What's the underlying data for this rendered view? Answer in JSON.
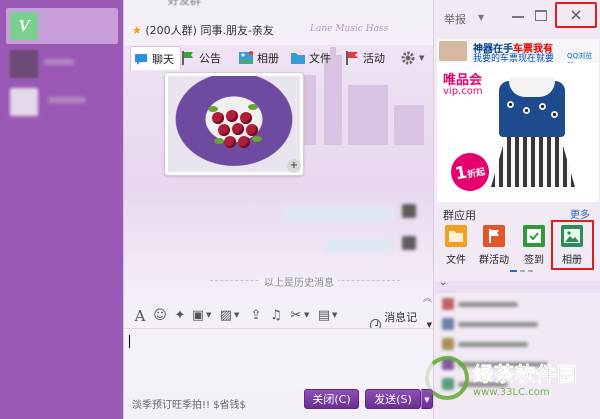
{
  "chat": {
    "top_clip_text": "好友群",
    "group_member_count": "(200人群)",
    "group_name": "同事.朋友-亲友",
    "background_script": "Lane Music Hass",
    "tabs": [
      {
        "label": "聊天",
        "icon": "chat-bubble-icon",
        "active": true
      },
      {
        "label": "公告",
        "icon": "flag-icon",
        "active": false
      },
      {
        "label": "相册",
        "icon": "photo-album-icon",
        "active": false
      },
      {
        "label": "文件",
        "icon": "folder-icon",
        "active": false
      },
      {
        "label": "活动",
        "icon": "activity-flag-icon",
        "active": false
      }
    ],
    "history_divider": "以上是历史消息",
    "message_history_label": "消息记录",
    "footer_tip": "淡季预订旺季拍!! $省钱$",
    "close_label": "关闭(C)",
    "send_label": "发送(S)",
    "dropdown_glyph": "▼",
    "collapse_glyph": "︽",
    "zoom_glyph": "+"
  },
  "right_panel": {
    "report_label": "举报",
    "close_glyph": "×",
    "ad": {
      "headline_a": "神器在手",
      "headline_b": "车票我有",
      "subline": "我要的车票现在就要",
      "qq_brand": "QQ浏览器",
      "shop_logo": "唯品会",
      "shop_domain": "vip.com",
      "discount_number": "1",
      "discount_unit": "折起"
    },
    "apps_title": "群应用",
    "apps_more": "更多",
    "apps": [
      {
        "label": "文件",
        "icon": "folder-icon",
        "color": "#f2a11f"
      },
      {
        "label": "群活动",
        "icon": "group-activity-icon",
        "color": "#e0572c"
      },
      {
        "label": "签到",
        "icon": "check-in-icon",
        "color": "#2e9b3a"
      },
      {
        "label": "相册",
        "icon": "album-icon",
        "color": "#2e8b57"
      }
    ],
    "member_bar_glyph": "⌄"
  },
  "watermark": {
    "main": "绿茶软件园",
    "sub": "www.33LC.com"
  },
  "colors": {
    "rail": "#9b59b6",
    "accent": "#6a2e95",
    "highlight_red": "#e01c1c"
  }
}
